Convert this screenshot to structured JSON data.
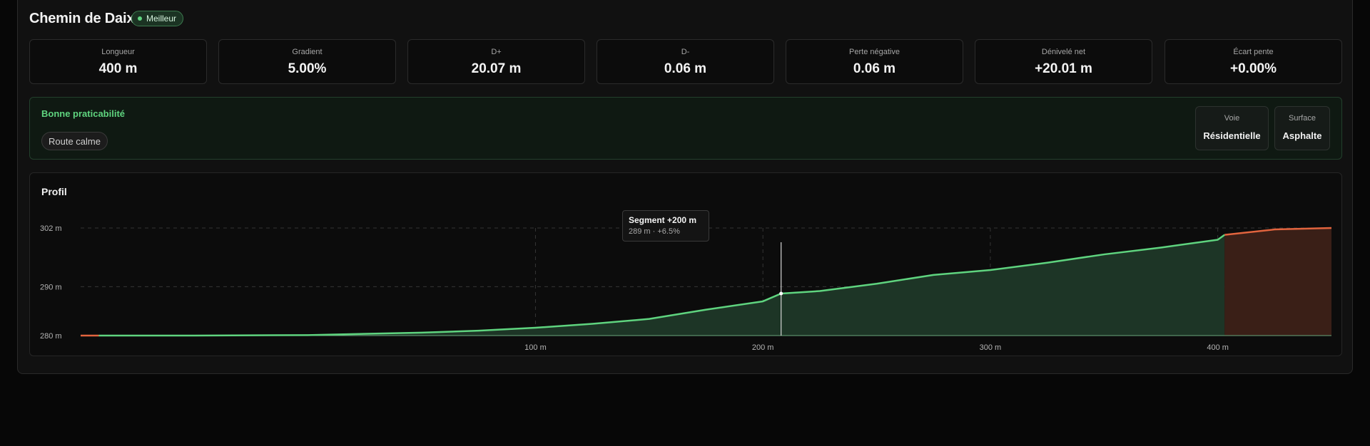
{
  "route": {
    "title": "Chemin de Daix",
    "badge": "Meilleur"
  },
  "stats": [
    {
      "label": "Longueur",
      "value": "400 m"
    },
    {
      "label": "Gradient",
      "value": "5.00%"
    },
    {
      "label": "D+",
      "value": "20.07 m"
    },
    {
      "label": "D-",
      "value": "0.06 m"
    },
    {
      "label": "Perte négative",
      "value": "0.06 m"
    },
    {
      "label": "Dénivelé net",
      "value": "+20.01 m"
    },
    {
      "label": "Écart pente",
      "value": "+0.00%"
    }
  ],
  "practicability": {
    "title": "Bonne praticabilité",
    "tag": "Route calme",
    "voie_label": "Voie",
    "voie_value": "Résidentielle",
    "surface_label": "Surface",
    "surface_value": "Asphalte"
  },
  "profile": {
    "title": "Profil",
    "tooltip_title": "Segment +200 m",
    "tooltip_detail": "289 m · +6.5%"
  },
  "colors": {
    "green": "#5fd47f",
    "orange": "#e2643e",
    "badge_bg": "#1b3323"
  },
  "chart_data": {
    "type": "area",
    "title": "Profil",
    "xlabel": "",
    "ylabel": "",
    "x_unit": "m",
    "y_unit": "m",
    "xlim": [
      -100,
      450
    ],
    "ylim": [
      280,
      302
    ],
    "x_ticks": [
      100,
      200,
      300,
      400
    ],
    "x_tick_labels": [
      "100 m",
      "200 m",
      "300 m",
      "400 m"
    ],
    "y_ticks": [
      280,
      290,
      302
    ],
    "y_tick_labels": [
      "280 m",
      "290 m",
      "302 m"
    ],
    "grid": true,
    "cursor_x": 208,
    "series": [
      {
        "color": "#e2643e",
        "x": [
          -100,
          -92
        ],
        "y": [
          280.0,
          280.0
        ]
      },
      {
        "color": "#5fd47f",
        "x": [
          -92,
          -50,
          0,
          50,
          75,
          100,
          125,
          150,
          175,
          200,
          208,
          225,
          250,
          275,
          300,
          325,
          350,
          375,
          400,
          403
        ],
        "y": [
          280.0,
          280.0,
          280.1,
          280.6,
          281.0,
          281.6,
          282.4,
          283.4,
          285.3,
          287.0,
          288.6,
          289.1,
          290.6,
          292.4,
          293.4,
          294.9,
          296.6,
          298.0,
          299.6,
          300.6
        ]
      },
      {
        "color": "#e2643e",
        "x": [
          403,
          425,
          450
        ],
        "y": [
          300.6,
          301.7,
          302.0
        ]
      }
    ],
    "highlight_start_x": 403
  }
}
